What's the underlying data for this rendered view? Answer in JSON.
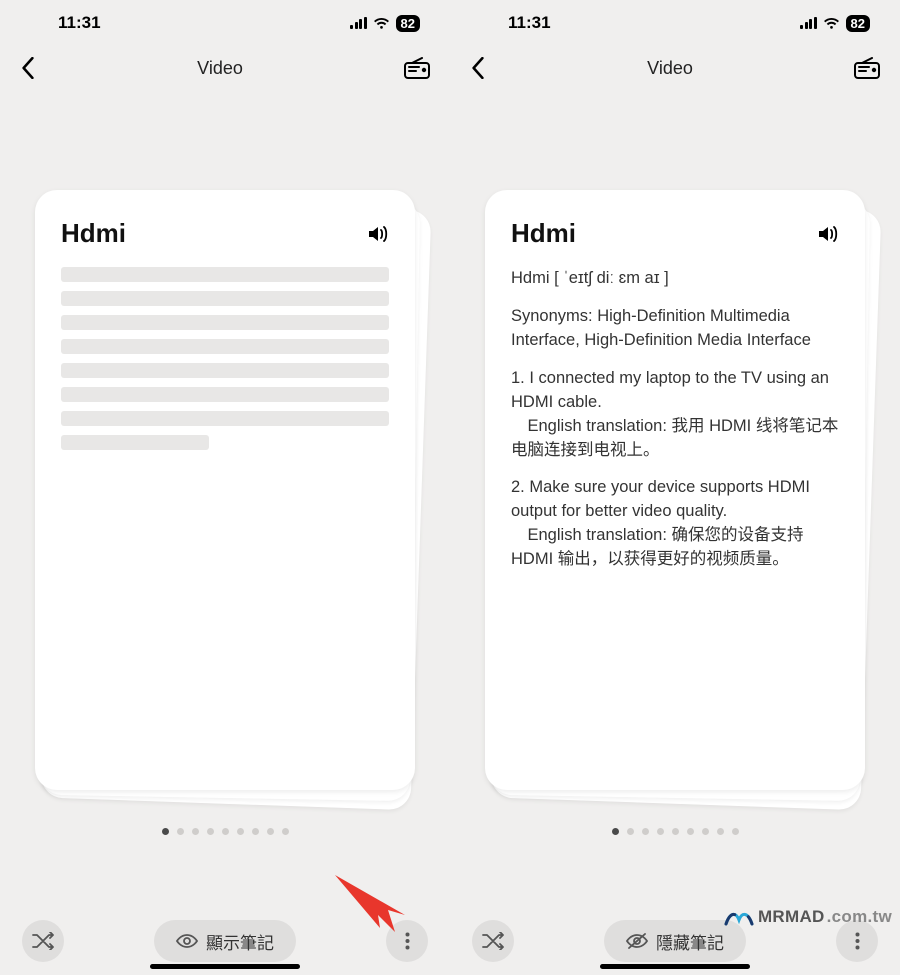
{
  "status": {
    "time": "11:31",
    "battery": "82"
  },
  "nav": {
    "title": "Video"
  },
  "left": {
    "card": {
      "title": "Hdmi"
    },
    "toggle_label": "顯示筆記"
  },
  "right": {
    "card": {
      "title": "Hdmi",
      "pron": "Hdmi [ ˈeɪtʃ diː ɛm aɪ ]",
      "synonyms": "Synonyms: High-Definition Multimedia Interface, High-Definition Media Interface",
      "ex1_en": "1. I connected my laptop to the TV using an HDMI cable.",
      "ex1_tr": "English translation: 我用 HDMI 线将笔记本电脑连接到电视上。",
      "ex2_en": "2. Make sure your device supports HDMI output for better video quality.",
      "ex2_tr": "English translation: 确保您的设备支持 HDMI 输出，以获得更好的视频质量。"
    },
    "toggle_label": "隱藏筆記"
  },
  "dots": {
    "count": 9,
    "active": 0
  },
  "watermark": {
    "brand": "MRMAD",
    "domain": ".com.tw"
  }
}
